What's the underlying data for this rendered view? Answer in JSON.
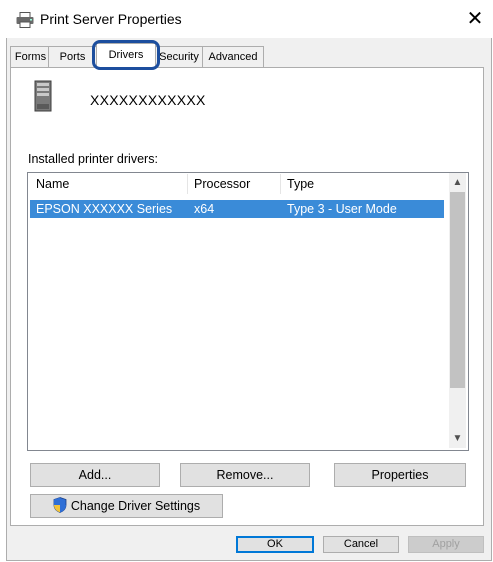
{
  "window": {
    "title": "Print Server Properties",
    "close_glyph": "✕",
    "title_icon": "printer-icon"
  },
  "tabs": [
    {
      "label": "Forms"
    },
    {
      "label": "Ports"
    },
    {
      "label": "Drivers",
      "active": true
    },
    {
      "label": "Security"
    },
    {
      "label": "Advanced"
    }
  ],
  "server": {
    "name": "XXXXXXXXXXXX",
    "icon": "server-icon"
  },
  "drivers": {
    "label": "Installed printer drivers:",
    "columns": [
      "Name",
      "Processor",
      "Type"
    ],
    "rows": [
      {
        "name": "EPSON XXXXXX Series",
        "processor": "x64",
        "type": "Type 3 - User Mode",
        "selected": true
      }
    ]
  },
  "buttons": {
    "add": "Add...",
    "remove": "Remove...",
    "properties": "Properties",
    "change_driver_settings": "Change Driver Settings",
    "ok": "OK",
    "cancel": "Cancel",
    "apply": "Apply"
  },
  "colors": {
    "selection": "#3a8bd8",
    "focus_highlight": "#1c4e9e",
    "default_button_border": "#0078d7"
  }
}
